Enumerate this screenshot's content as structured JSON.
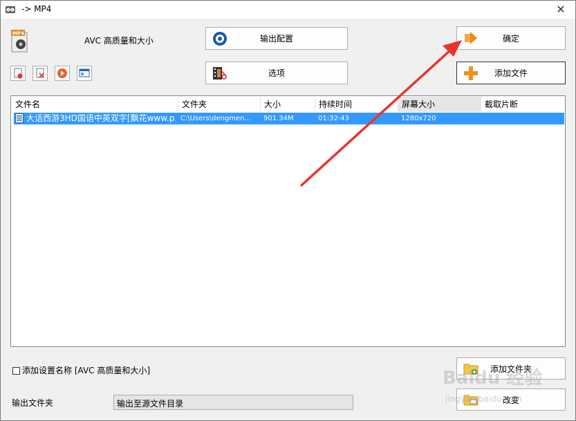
{
  "window": {
    "title": "-> MP4",
    "close_glyph": "✕"
  },
  "profile": {
    "label": "AVC 高质量和大小"
  },
  "buttons": {
    "output_config": "输出配置",
    "options": "选项",
    "confirm": "确定",
    "add_file": "添加文件",
    "add_folder": "添加文件夹",
    "change": "改变"
  },
  "table": {
    "columns": [
      "文件名",
      "文件夹",
      "大小",
      "持续时间",
      "屏幕大小",
      "截取片断"
    ],
    "rows": [
      {
        "name": "大话西游3HD国语中英双字[飘花www.p...",
        "folder": "C:\\Users\\dengmen...",
        "size": "901.34M",
        "duration": "01:32:43",
        "screen": "1280x720",
        "clip": ""
      }
    ]
  },
  "settings": {
    "add_name_label": "添加设置名称 [AVC 高质量和大小]",
    "output_folder_label": "输出文件夹",
    "output_folder_value": "输出至源文件目录"
  },
  "watermark": {
    "brand": "Baidu 经验",
    "url": "jingyan.baidu.com"
  },
  "colors": {
    "selection": "#3399ff",
    "annotation_arrow": "#e8352b"
  }
}
